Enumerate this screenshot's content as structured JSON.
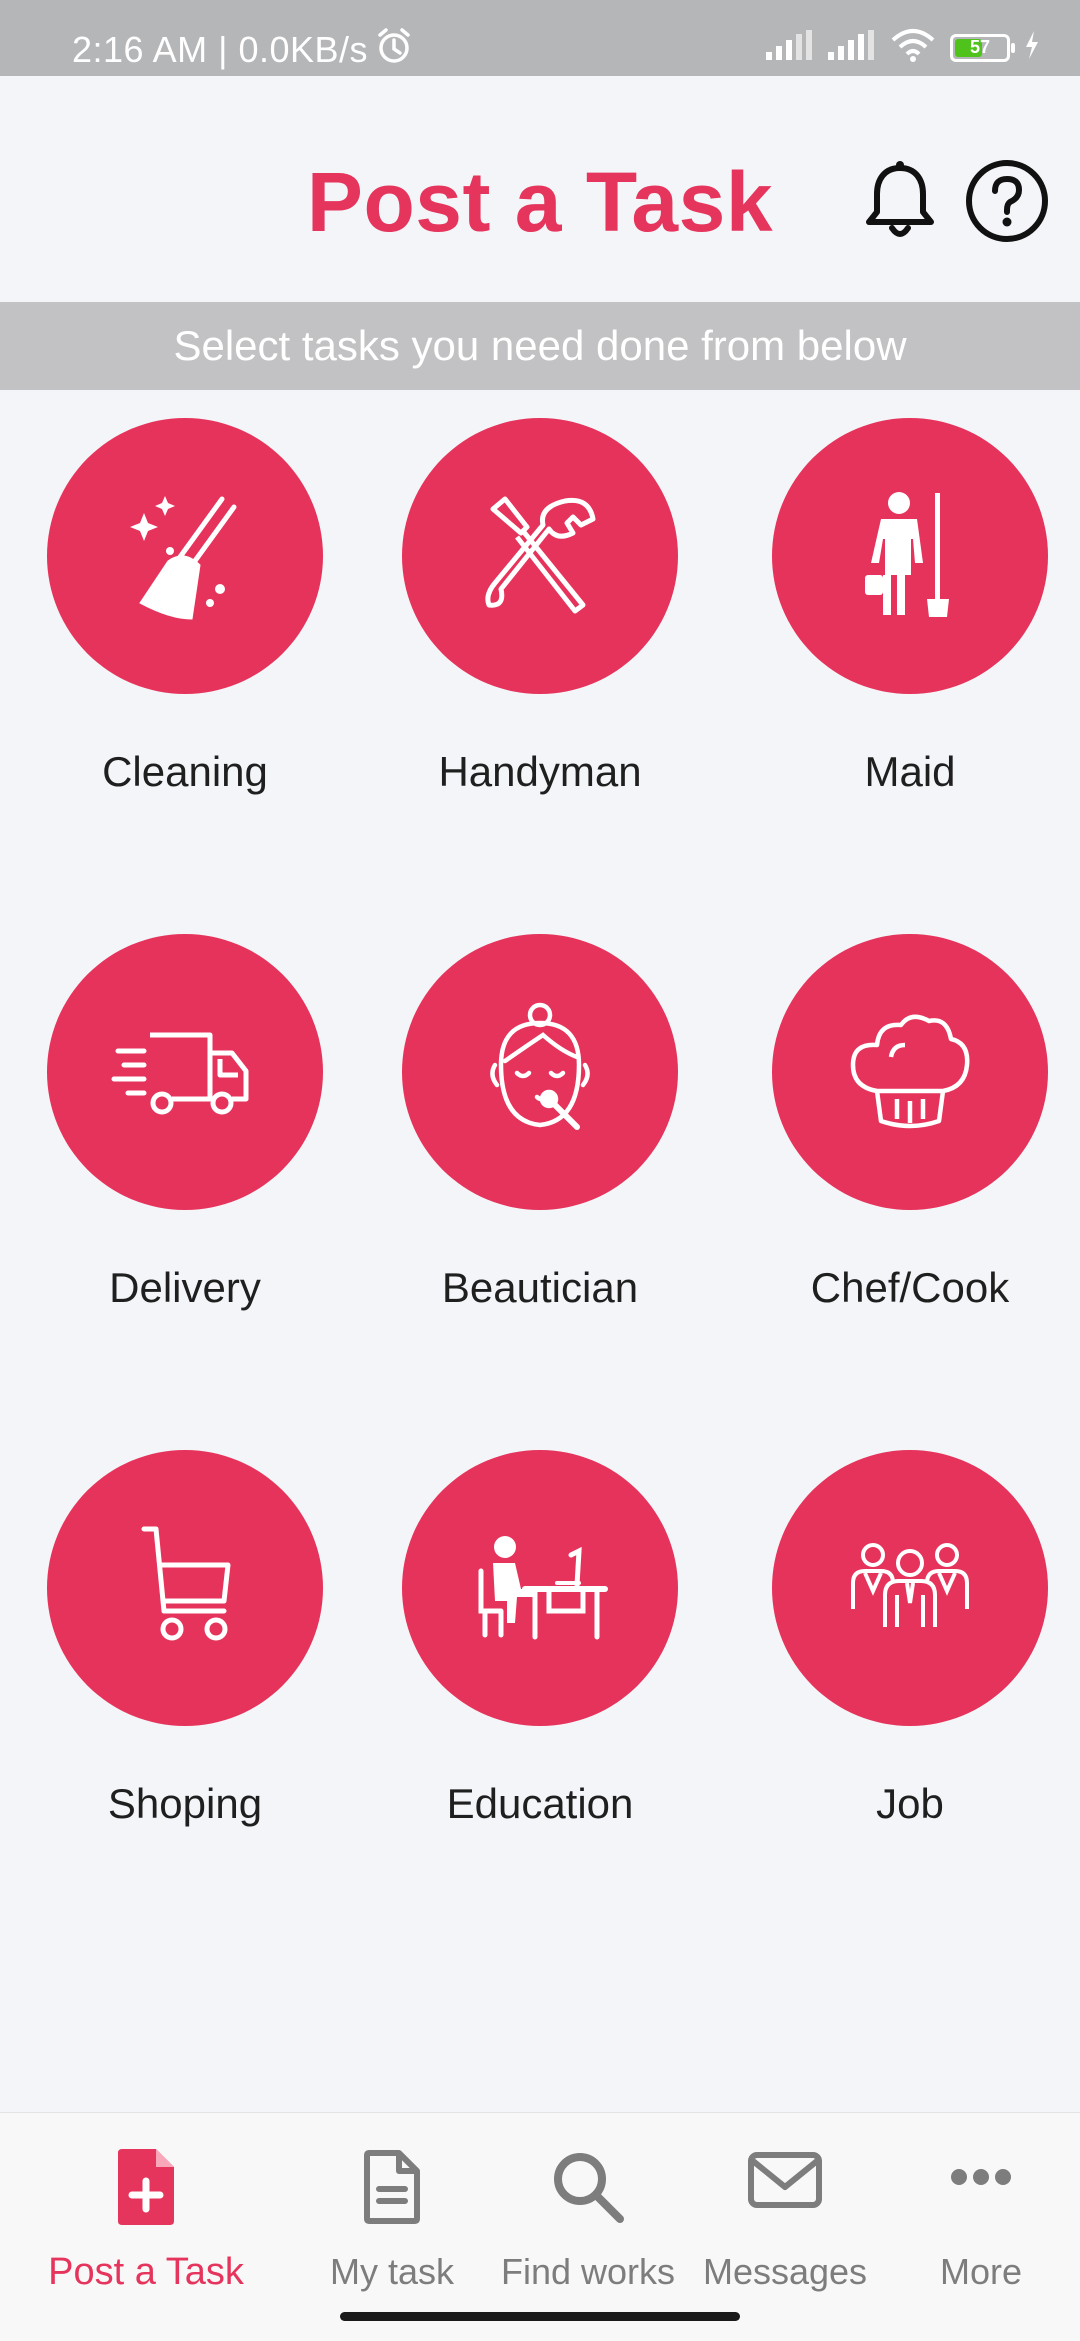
{
  "status_bar": {
    "time_text": "2:16 AM | 0.0KB/s",
    "battery_level": 57,
    "battery_text": "57"
  },
  "header": {
    "title": "Post a Task"
  },
  "subtitle": "Select tasks you need done from below",
  "categories": [
    {
      "label": "Cleaning",
      "icon": "broom-icon"
    },
    {
      "label": "Handyman",
      "icon": "tools-icon"
    },
    {
      "label": "Maid",
      "icon": "maid-icon"
    },
    {
      "label": "Delivery",
      "icon": "truck-icon"
    },
    {
      "label": "Beautician",
      "icon": "makeup-face-icon"
    },
    {
      "label": "Chef/Cook",
      "icon": "chef-hat-icon"
    },
    {
      "label": "Shoping",
      "icon": "cart-icon"
    },
    {
      "label": "Education",
      "icon": "desk-study-icon"
    },
    {
      "label": "Job",
      "icon": "people-group-icon"
    }
  ],
  "bottom_nav": [
    {
      "label": "Post a Task",
      "icon": "document-plus-icon",
      "active": true
    },
    {
      "label": "My task",
      "icon": "document-icon",
      "active": false
    },
    {
      "label": "Find works",
      "icon": "search-icon",
      "active": false
    },
    {
      "label": "Messages",
      "icon": "envelope-icon",
      "active": false
    },
    {
      "label": "More",
      "icon": "more-dots-icon",
      "active": false
    }
  ],
  "colors": {
    "accent": "#e6355c",
    "circle": "#e6335b",
    "status_bar": "#b5b6b8",
    "subtitle_bar": "#c2c2c4",
    "background": "#f3f5f9",
    "nav_inactive": "#7d7d7d"
  }
}
